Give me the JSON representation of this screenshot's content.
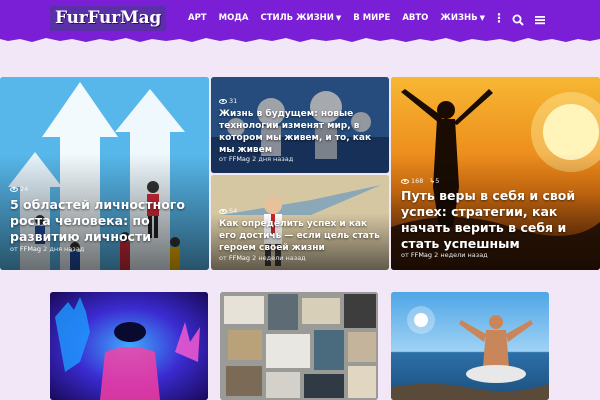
{
  "site": {
    "logo": "FurFurMag"
  },
  "nav": {
    "items": [
      {
        "label": "АРТ",
        "dropdown": false
      },
      {
        "label": "МОДА",
        "dropdown": false
      },
      {
        "label": "СТИЛЬ ЖИЗНИ",
        "dropdown": true
      },
      {
        "label": "В МИРЕ",
        "dropdown": false
      },
      {
        "label": "АВТО",
        "dropdown": false
      },
      {
        "label": "ЖИЗНЬ",
        "dropdown": true
      }
    ],
    "more": "⋮",
    "icons": [
      "search-icon",
      "menu-icon"
    ]
  },
  "colors": {
    "header": "#7a1fd6",
    "background": "#f1e7f7",
    "logo_bg": "#5b2fa8"
  },
  "featured": [
    {
      "title": "5 областей личностного роста человека: по развитию личности",
      "views": "24",
      "author_prefix": "от",
      "author": "FFMag",
      "time": "2 дня назад"
    },
    {
      "title": "Жизнь в будущем: новые технологии изменят мир, в котором мы живем, и то, как мы живем",
      "views": "31",
      "author_prefix": "от",
      "author": "FFMag",
      "time": "2 дня назад"
    },
    {
      "title": "Как определить успех и как его достичь — если цель стать героем своей жизни",
      "views": "54",
      "author_prefix": "от",
      "author": "FFMag",
      "time": "2 недели назад"
    },
    {
      "title": "Путь веры в себя и свой успех: стратегии, как начать верить в себя и стать успешным",
      "views": "168",
      "shares": "5",
      "author_prefix": "от",
      "author": "FFMag",
      "time": "2 недели назад"
    }
  ],
  "bottom": [
    {
      "views": "",
      "image": "vr-person"
    },
    {
      "views": "",
      "image": "vision-board"
    },
    {
      "views": "",
      "image": "meditation-beach"
    }
  ]
}
